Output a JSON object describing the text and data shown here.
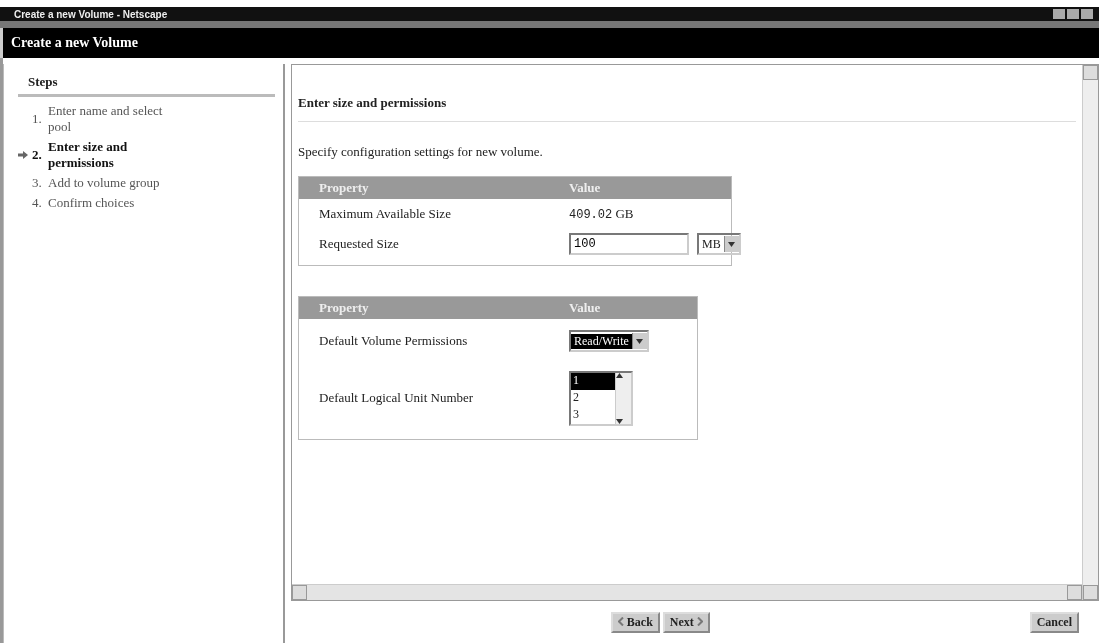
{
  "window": {
    "title": "Create a new Volume - Netscape"
  },
  "header": {
    "title": "Create a new Volume"
  },
  "steps": {
    "heading": "Steps",
    "items": [
      {
        "number": "1.",
        "label": "Enter name and select pool",
        "selected": false
      },
      {
        "number": "2.",
        "label": "Enter size and permissions",
        "selected": true
      },
      {
        "number": "3.",
        "label": "Add to volume group",
        "selected": false
      },
      {
        "number": "4.",
        "label": "Confirm choices",
        "selected": false
      }
    ]
  },
  "page": {
    "title": "Enter size and permissions",
    "intro": "Specify configuration settings for new volume.",
    "tables": [
      {
        "columns": [
          "Property",
          "Value"
        ],
        "rows": [
          {
            "kind": "text",
            "label": "Maximum Available Size",
            "number": "409.02",
            "unit": "GB"
          },
          {
            "kind": "input",
            "label": "Requested Size",
            "value": "100",
            "select": "MB"
          }
        ]
      },
      {
        "columns": [
          "Property",
          "Value"
        ],
        "rows": [
          {
            "kind": "select",
            "label": "Default Volume Permissions",
            "select": "Read/Write"
          },
          {
            "kind": "list",
            "label": "Default Logical Unit Number",
            "options": [
              {
                "label": "1",
                "selected": true
              },
              {
                "label": "2",
                "selected": false
              },
              {
                "label": "3",
                "selected": false
              }
            ]
          }
        ]
      }
    ]
  },
  "buttons": {
    "back": "Back",
    "next": "Next",
    "cancel": "Cancel"
  }
}
